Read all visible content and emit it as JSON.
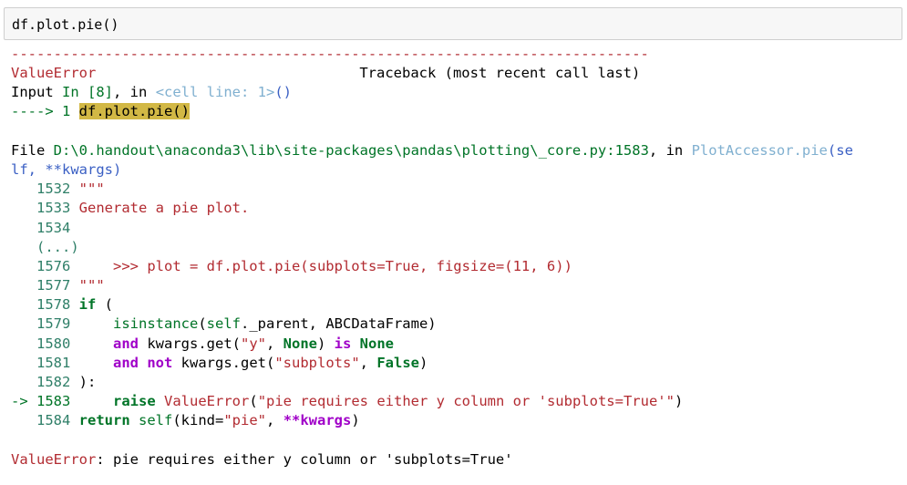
{
  "input_cell": {
    "code": "df.plot.pie()"
  },
  "traceback": {
    "separator": "---------------------------------------------------------------------------",
    "error_name": "ValueError",
    "traceback_title": "Traceback (most recent call last)",
    "input_label": "Input",
    "in_label": "In [8]",
    "in_sep": ", in ",
    "cell_ref": "<cell line: 1>",
    "call_parens": "()",
    "arrow_line_prefix": "----> 1 ",
    "arrow_line_code": "df.plot.pie()",
    "file_prefix": "File ",
    "file_path": "D:\\0.handout\\anaconda3\\lib\\site-packages\\pandas\\plotting\\_core.py:1583",
    "file_sep": ", in ",
    "func_name": "PlotAccessor.pie",
    "func_open": "(",
    "func_args_a": "se",
    "func_args_b": "lf",
    "func_args_c": ", ",
    "func_args_d": "**kwargs",
    "func_close": ")",
    "code": {
      "l1532_no": "1532",
      "l1532_code": "\"\"\"",
      "l1533_no": "1533",
      "l1533_code": "Generate a pie plot.",
      "l1534_no": "1534",
      "ellipsis": "(...)",
      "l1576_no": "1576",
      "l1576_code": "    >>> plot = df.plot.pie(subplots=True, figsize=(11, 6))",
      "l1577_no": "1577",
      "l1577_code": "\"\"\"",
      "l1578_no": "1578",
      "l1578_kw": "if",
      "l1578_rest": " (",
      "l1579_no": "1579",
      "l1579_fn": "isinstance",
      "l1579_open": "(",
      "l1579_self": "self",
      "l1579_rest": "._parent, ABCDataFrame)",
      "l1580_no": "1580",
      "l1580_kw": "and",
      "l1580_a": " kwargs.get(",
      "l1580_str": "\"y\"",
      "l1580_b": ", ",
      "l1580_none": "None",
      "l1580_c": ") ",
      "l1580_is": "is",
      "l1580_d": " ",
      "l1580_none2": "None",
      "l1581_no": "1581",
      "l1581_kw": "and",
      "l1581_not": "not",
      "l1581_a": " kwargs.get(",
      "l1581_str": "\"subplots\"",
      "l1581_b": ", ",
      "l1581_false": "False",
      "l1581_c": ")",
      "l1582_no": "1582",
      "l1582_code": "):",
      "l1583_arrow": "-> 1583",
      "l1583_raise": "raise",
      "l1583_err": "ValueError",
      "l1583_open": "(",
      "l1583_str": "\"pie requires either y column or 'subplots=True'\"",
      "l1583_close": ")",
      "l1584_no": "1584",
      "l1584_ret": "return",
      "l1584_self": "self",
      "l1584_a": "(kind=",
      "l1584_str": "\"pie\"",
      "l1584_b": ", ",
      "l1584_kw": "**kwargs",
      "l1584_c": ")"
    },
    "final_error_name": "ValueError",
    "final_message": ": pie requires either y column or 'subplots=True'"
  },
  "colors": {
    "error_red": "#b22b31",
    "keyword_green": "#007427",
    "operator_purple": "#a000c8",
    "highlight": "#d2b845",
    "cell_bg": "#f7f7f7"
  }
}
